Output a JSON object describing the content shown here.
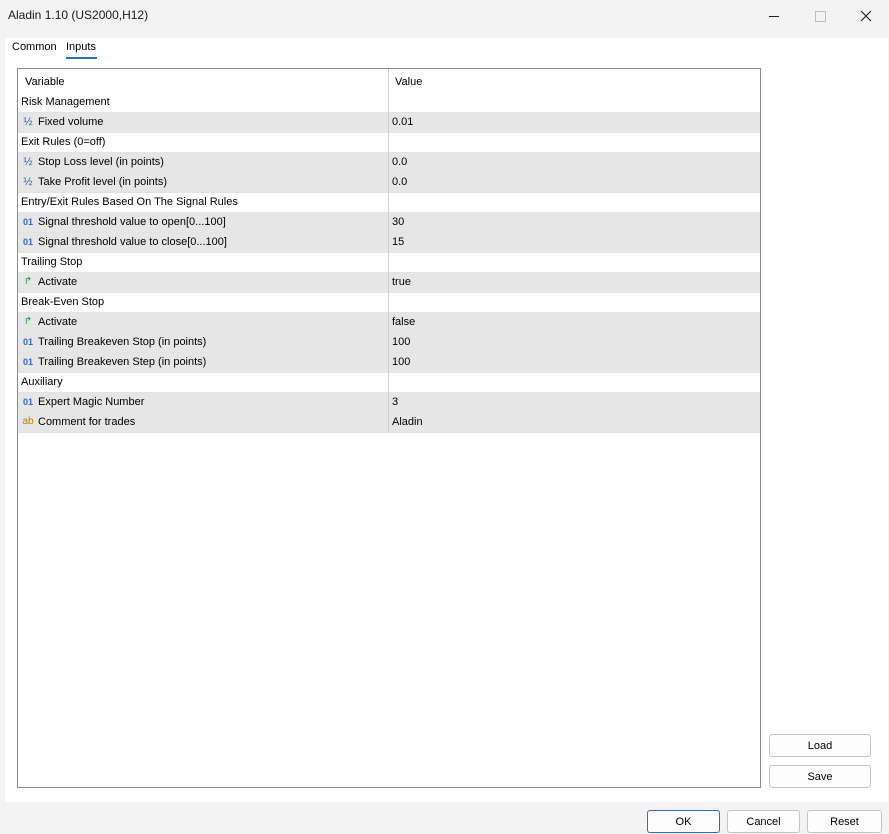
{
  "window": {
    "title": "Aladin 1.10 (US2000,H12)",
    "minimize_icon": "minimize-icon",
    "maximize_icon": "maximize-icon",
    "close_icon": "close-icon"
  },
  "tabs": [
    {
      "label": "Common",
      "selected": false
    },
    {
      "label": "Inputs",
      "selected": true
    }
  ],
  "grid": {
    "headers": {
      "variable": "Variable",
      "value": "Value"
    },
    "rows": [
      {
        "type": "group",
        "variable": "Risk Management",
        "value": ""
      },
      {
        "type": "double",
        "icon": "½",
        "variable": "Fixed volume",
        "value": "0.01"
      },
      {
        "type": "group",
        "variable": "Exit Rules (0=off)",
        "value": ""
      },
      {
        "type": "double",
        "icon": "½",
        "variable": "Stop Loss level (in points)",
        "value": "0.0"
      },
      {
        "type": "double",
        "icon": "½",
        "variable": "Take Profit level (in points)",
        "value": "0.0"
      },
      {
        "type": "group",
        "variable": "Entry/Exit Rules Based On The Signal Rules",
        "value": ""
      },
      {
        "type": "int",
        "icon": "01",
        "variable": "Signal threshold value to open[0...100]",
        "value": "30"
      },
      {
        "type": "int",
        "icon": "01",
        "variable": "Signal threshold value to close[0...100]",
        "value": "15"
      },
      {
        "type": "group",
        "variable": "Trailing Stop",
        "value": ""
      },
      {
        "type": "bool",
        "icon": "↱",
        "variable": "Activate",
        "value": "true"
      },
      {
        "type": "group",
        "variable": "Break-Even Stop",
        "value": ""
      },
      {
        "type": "bool",
        "icon": "↱",
        "variable": "Activate",
        "value": "false"
      },
      {
        "type": "int",
        "icon": "01",
        "variable": "Trailing Breakeven Stop (in points)",
        "value": "100"
      },
      {
        "type": "int",
        "icon": "01",
        "variable": "Trailing Breakeven Step (in points)",
        "value": "100"
      },
      {
        "type": "group",
        "variable": "Auxiliary",
        "value": ""
      },
      {
        "type": "int",
        "icon": "01",
        "variable": "Expert Magic Number",
        "value": "3"
      },
      {
        "type": "string",
        "icon": "ab",
        "variable": "Comment for trades",
        "value": "Aladin"
      }
    ]
  },
  "side_buttons": {
    "load": "Load",
    "save": "Save"
  },
  "footer_buttons": {
    "ok": "OK",
    "cancel": "Cancel",
    "reset": "Reset"
  }
}
